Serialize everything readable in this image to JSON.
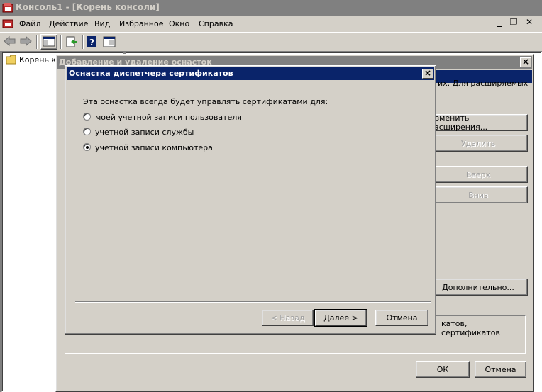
{
  "app": {
    "title": "Консоль1 - [Корень консоли]",
    "menu": [
      "Файл",
      "Действие",
      "Вид",
      "Избранное",
      "Окно",
      "Справка"
    ]
  },
  "tree": {
    "root": "Корень ко"
  },
  "snapin_dialog": {
    "title": "Добавление и удаление оснасток",
    "right_text": "их. Для расширяемых",
    "edit_extensions": "Изменить расширения...",
    "remove": "Удалить",
    "up": "Вверх",
    "down": "Вниз",
    "advanced": "Дополнительно...",
    "description": "катов, сертификатов",
    "ok": "ОК",
    "cancel": "Отмена"
  },
  "cert_dialog": {
    "title": "Оснастка диспетчера сертификатов",
    "prompt": "Эта оснастка всегда будет управлять сертификатами для:",
    "options": [
      "моей учетной записи пользователя",
      "учетной записи службы",
      "учетной записи компьютера"
    ],
    "selected_index": 2,
    "back": "< Назад",
    "next": "Далее >",
    "cancel": "Отмена"
  }
}
